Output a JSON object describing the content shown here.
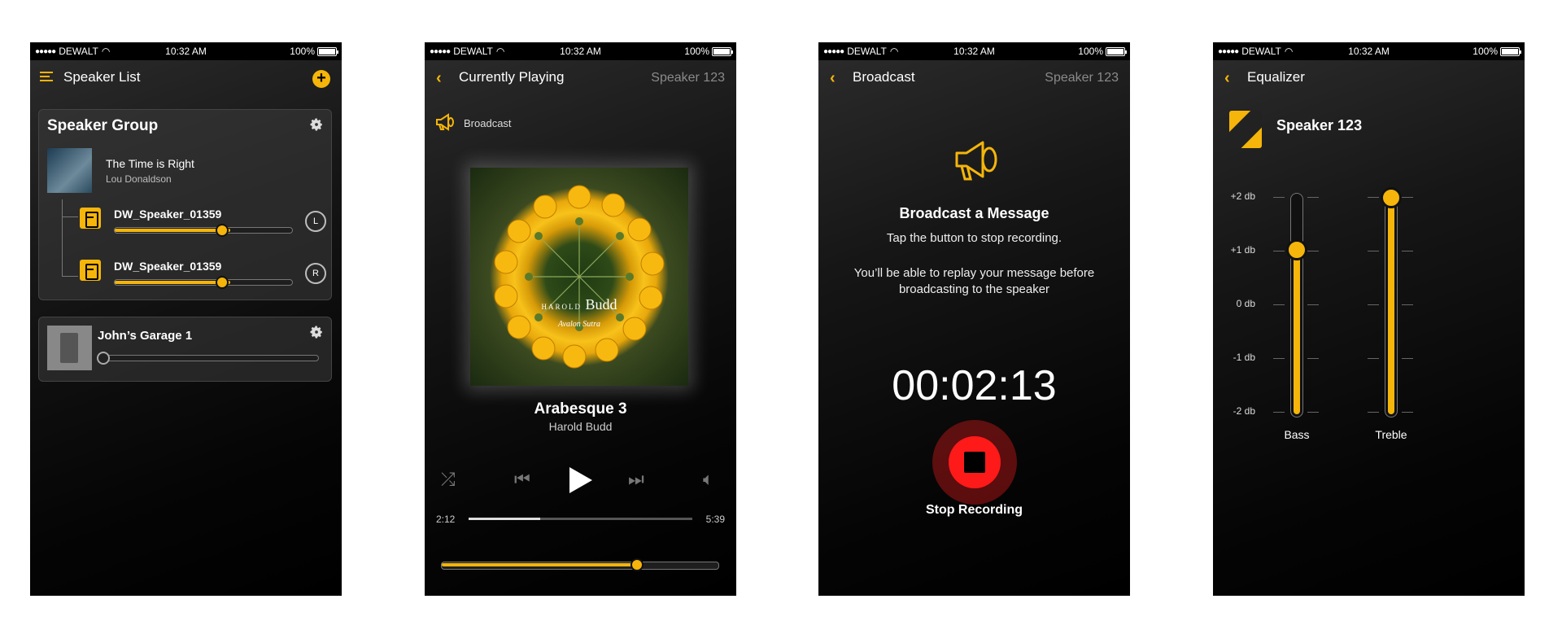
{
  "status": {
    "carrier": "DEWALT",
    "time": "10:32 AM",
    "battery": "100%"
  },
  "screen1": {
    "title": "Speaker List",
    "group": {
      "title": "Speaker Group",
      "now_playing": {
        "title": "The Time is Right",
        "artist": "Lou Donaldson"
      },
      "speakers": [
        {
          "name": "DW_Speaker_01359",
          "channel": "L",
          "volume": 0.65
        },
        {
          "name": "DW_Speaker_01359",
          "channel": "R",
          "volume": 0.65
        }
      ]
    },
    "standalone": {
      "name": "John’s Garage 1",
      "volume": 0.0
    }
  },
  "screen2": {
    "title": "Currently Playing",
    "speaker": "Speaker 123",
    "broadcast_label": "Broadcast",
    "album_art_text": "Budd",
    "album_art_line1": "HAROLD",
    "album_art_line2": "Avalon Sutra",
    "song": {
      "title": "Arabesque 3",
      "artist": "Harold Budd"
    },
    "elapsed": "2:12",
    "duration": "5:39",
    "progress": 0.32,
    "volume": 0.7
  },
  "screen3": {
    "title": "Broadcast",
    "speaker": "Speaker 123",
    "heading": "Broadcast a Message",
    "subheading": "Tap the button to stop recording.",
    "description": "You’ll be able to replay your message before broadcasting to the speaker",
    "timer": "00:02:13",
    "stop_label": "Stop Recording"
  },
  "screen4": {
    "title": "Equalizer",
    "speaker": "Speaker 123",
    "db_labels": [
      "+2 db",
      "+1 db",
      "0 db",
      "-1 db",
      "-2 db"
    ],
    "bands": [
      {
        "name": "Bass",
        "value_db": 1
      },
      {
        "name": "Treble",
        "value_db": 2
      }
    ]
  },
  "colors": {
    "accent": "#f5b50a",
    "record": "#ff1a1a"
  }
}
